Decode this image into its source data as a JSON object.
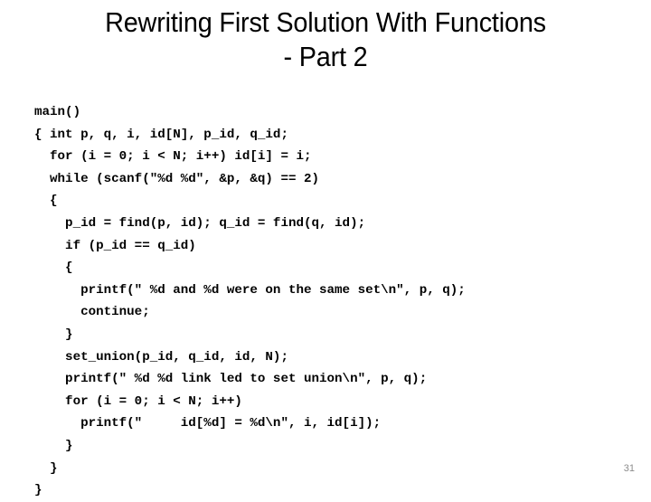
{
  "slide": {
    "background_color": "#ffffff",
    "text_color": "#000000"
  },
  "title": {
    "line1": "Rewriting First Solution With Functions",
    "line2": "- Part 2",
    "full": "Rewriting First Solution With Functions - Part 2"
  },
  "code": {
    "language": "C",
    "lines": [
      "main()",
      "{ int p, q, i, id[N], p_id, q_id;",
      "  for (i = 0; i < N; i++) id[i] = i;",
      "  while (scanf(\"%d %d\", &p, &q) == 2)",
      "  {",
      "    p_id = find(p, id); q_id = find(q, id);",
      "    if (p_id == q_id)",
      "    {",
      "      printf(\" %d and %d were on the same set\\n\", p, q);",
      "      continue;",
      "    }",
      "    set_union(p_id, q_id, id, N);",
      "    printf(\" %d %d link led to set union\\n\", p, q);",
      "    for (i = 0; i < N; i++)",
      "      printf(\"     id[%d] = %d\\n\", i, id[i]);",
      "    }",
      "  }",
      "}"
    ]
  },
  "footer": {
    "page_number": "31",
    "page_number_color": "#8c8c8c"
  }
}
